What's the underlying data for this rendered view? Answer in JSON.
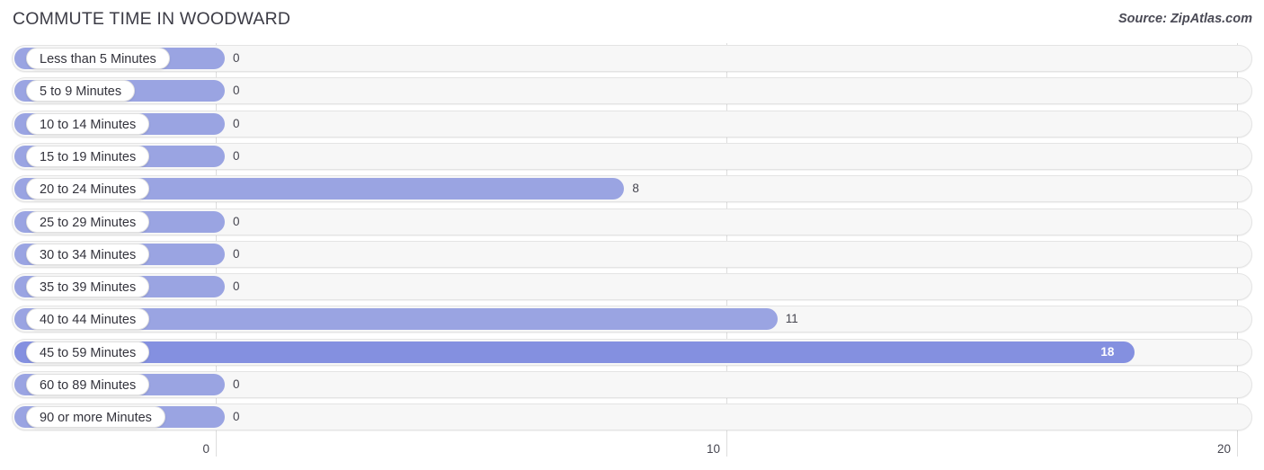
{
  "header": {
    "title": "COMMUTE TIME IN WOODWARD",
    "source": "Source: ZipAtlas.com"
  },
  "colors": {
    "bar": "#9aa4e2",
    "bar_strong": "#8490e0",
    "track": "#f7f7f7",
    "gridline": "#dddddd",
    "label_pill": "#ffffff",
    "text": "#45454f"
  },
  "chart_data": {
    "type": "bar",
    "orientation": "horizontal",
    "title": "COMMUTE TIME IN WOODWARD",
    "xlabel": "",
    "ylabel": "",
    "xlim": [
      0,
      20
    ],
    "grid": true,
    "legend": null,
    "ticks": [
      "0",
      "10",
      "20"
    ],
    "tick_values": [
      0,
      10,
      20
    ],
    "categories": [
      "Less than 5 Minutes",
      "5 to 9 Minutes",
      "10 to 14 Minutes",
      "15 to 19 Minutes",
      "20 to 24 Minutes",
      "25 to 29 Minutes",
      "30 to 34 Minutes",
      "35 to 39 Minutes",
      "40 to 44 Minutes",
      "45 to 59 Minutes",
      "60 to 89 Minutes",
      "90 or more Minutes"
    ],
    "values": [
      0,
      0,
      0,
      0,
      8,
      0,
      0,
      0,
      11,
      18,
      0,
      0
    ],
    "labels": [
      "0",
      "0",
      "0",
      "0",
      "8",
      "0",
      "0",
      "0",
      "11",
      "18",
      "0",
      "0"
    ]
  }
}
